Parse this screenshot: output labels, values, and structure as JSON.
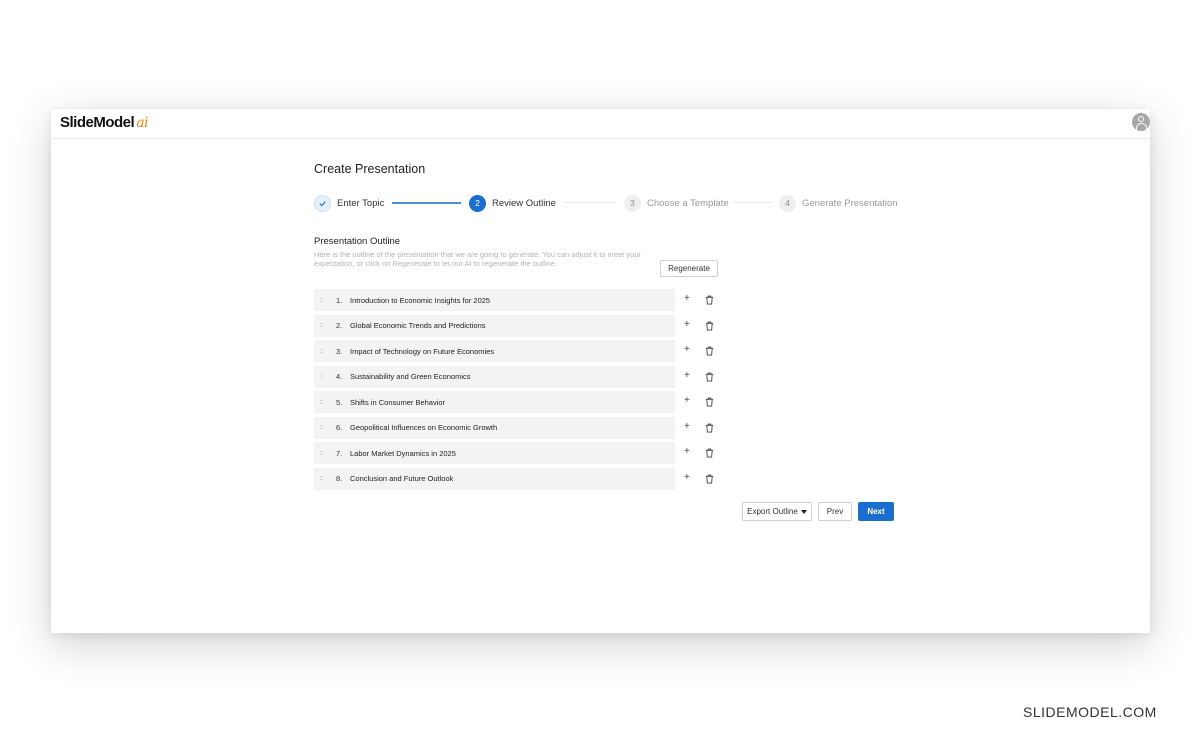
{
  "app": {
    "logo_text": "SlideModel",
    "logo_suffix": "ai"
  },
  "page": {
    "title": "Create Presentation"
  },
  "stepper": {
    "steps": [
      {
        "number": "✓",
        "label": "Enter Topic",
        "state": "done"
      },
      {
        "number": "2",
        "label": "Review Outline",
        "state": "active"
      },
      {
        "number": "3",
        "label": "Choose a Template",
        "state": "todo"
      },
      {
        "number": "4",
        "label": "Generate Presentation",
        "state": "todo"
      }
    ]
  },
  "outline": {
    "title": "Presentation Outline",
    "description": "Here is the outline of the presentation that we are going to generate. You can adjust it to meet your expectation, or click on Regenerate to let our AI to regenerate the outline.",
    "regenerate_label": "Regenerate",
    "items": [
      {
        "num": "1.",
        "text": "Introduction to Economic Insights for 2025"
      },
      {
        "num": "2.",
        "text": "Global Economic Trends and Predictions"
      },
      {
        "num": "3.",
        "text": "Impact of Technology on Future Economies"
      },
      {
        "num": "4.",
        "text": "Sustainability and Green Economics"
      },
      {
        "num": "5.",
        "text": "Shifts in Consumer Behavior"
      },
      {
        "num": "6.",
        "text": "Geopolitical Influences on Economic Growth"
      },
      {
        "num": "7.",
        "text": "Labor Market Dynamics in 2025"
      },
      {
        "num": "8.",
        "text": "Conclusion and Future Outlook"
      }
    ],
    "grip_glyph": "::",
    "add_glyph": "+"
  },
  "actions": {
    "export_label": "Export Outline",
    "prev_label": "Prev",
    "next_label": "Next"
  },
  "colors": {
    "accent": "#1a6fce",
    "logo_ai": "#e8891d"
  },
  "icons": [
    "check-icon",
    "grip-icon",
    "plus-icon",
    "trash-icon",
    "caret-down-icon",
    "user-avatar-icon"
  ],
  "watermark": "SLIDEMODEL.COM"
}
